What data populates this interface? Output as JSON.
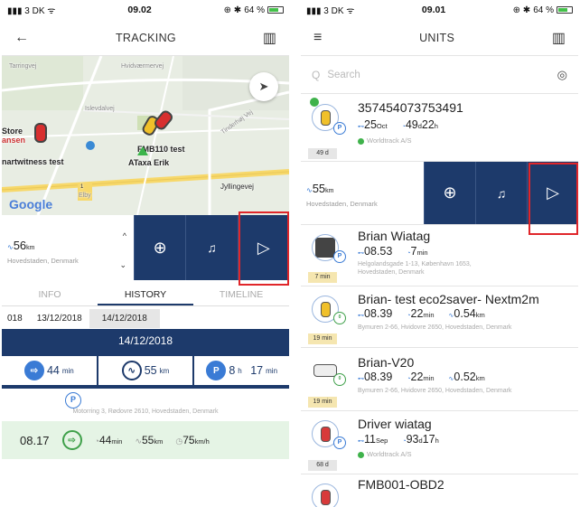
{
  "colors": {
    "navy": "#1d3a6b",
    "accent_blue": "#3a7bd5",
    "highlight_red": "#e0262a",
    "trip_green": "#e5f4e5"
  },
  "left": {
    "status": {
      "carrier": "3 DK",
      "time": "09.02",
      "battery": "64 %"
    },
    "topbar": {
      "title": "TRACKING",
      "back_icon": "back-arrow-icon",
      "map_icon": "map-icon"
    },
    "map": {
      "labels": {
        "store": "Store",
        "ansen": "ansen",
        "fmb": "FMB110 test",
        "smartwitness": "nartwitness test",
        "ataxa": "ATaxa Erik",
        "jyllinge": "Jyllingevej",
        "tarringvej": "Tarringvej",
        "hvidovre": "Hvidværmervej",
        "islevdal": "Islevdalvej",
        "tinderhoj": "Tinderhøj Vej",
        "elby": "Elby"
      },
      "google": "Google",
      "road_number": "1"
    },
    "selected_unit": {
      "distance": "56",
      "distance_unit": "km",
      "region": "Hovedstaden, Denmark"
    },
    "tabs": [
      {
        "label": "INFO"
      },
      {
        "label": "HISTORY"
      },
      {
        "label": "TIMELINE"
      }
    ],
    "dates": [
      "018",
      "13/12/2018",
      "14/12/2018"
    ],
    "day_header": "14/12/2018",
    "summary": [
      {
        "value": "44",
        "unit": "min"
      },
      {
        "value": "55",
        "unit": "km"
      },
      {
        "value": "8",
        "unit1": "h",
        "value2": "17",
        "unit2": "min"
      }
    ],
    "parked_address": "Motorring 3, Rødovre 2610, Hovedstaden, Denmark",
    "trip": {
      "time": "08.17",
      "duration": "44",
      "duration_unit": "min",
      "distance": "55",
      "distance_unit": "km",
      "speed": "75",
      "speed_unit": "km/h"
    }
  },
  "right": {
    "status": {
      "carrier": "3 DK",
      "time": "09.01",
      "battery": "64 %"
    },
    "topbar": {
      "title": "UNITS",
      "menu_icon": "hamburger-icon",
      "map_icon": "map-icon"
    },
    "search": {
      "placeholder": "Search"
    },
    "units": [
      {
        "name": "357454073753491",
        "time": "25",
        "time_unit": "Oct",
        "duration_a": "49",
        "duration_a_unit": "d",
        "duration_b": "22",
        "duration_b_unit": "h",
        "group": "Worldtrack A/S",
        "badge": "49 d"
      },
      {
        "name": "Brian Wiatag",
        "time": "08.53",
        "duration": "7",
        "duration_unit": "min",
        "address": "Helgolandsgade 1-13, København 1653,",
        "address2": "Hovedstaden, Denmark",
        "badge": "7 min"
      },
      {
        "name": "Brian- test eco2saver- Nextm2m",
        "time": "08.39",
        "duration": "22",
        "duration_unit": "min",
        "distance": "0.54",
        "distance_unit": "km",
        "address": "Bymuren 2-66, Hvidovre 2650, Hovedstaden, Denmark",
        "badge": "19 min"
      },
      {
        "name": "Brian-V20",
        "time": "08.39",
        "duration": "22",
        "duration_unit": "min",
        "distance": "0.52",
        "distance_unit": "km",
        "address": "Bymuren 2-66, Hvidovre 2650, Hovedstaden, Denmark",
        "badge": "19 min"
      },
      {
        "name": "Driver wiatag",
        "time": "11",
        "time_unit": "Sep",
        "duration_a": "93",
        "duration_a_unit": "d",
        "duration_b": "17",
        "duration_b_unit": "h",
        "group": "Worldtrack A/S",
        "badge": "68 d"
      },
      {
        "name": "FMB001-OBD2"
      }
    ],
    "selected_unit": {
      "distance": "55",
      "distance_unit": "km",
      "region": "Hovedstaden, Denmark"
    }
  }
}
